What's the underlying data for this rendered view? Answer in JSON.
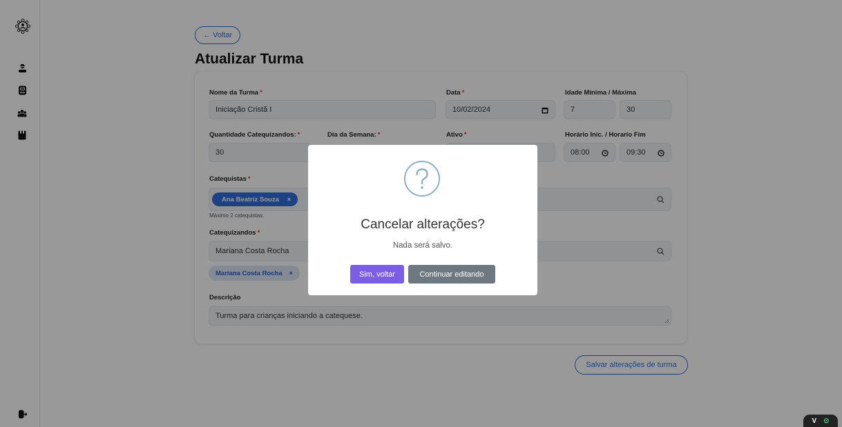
{
  "header": {
    "back_label": "← Voltar",
    "title": "Atualizar Turma"
  },
  "sidebar": {
    "icons": [
      "logo-icon",
      "user-icon",
      "book-icon",
      "group-icon",
      "notebook-icon",
      "logout-icon"
    ]
  },
  "form": {
    "nome": {
      "label": "Nome da Turma",
      "value": "Iniciação Cristã I"
    },
    "data": {
      "label": "Data",
      "value": "10/02/2024"
    },
    "idade": {
      "label": "Idade Mínima / Máxima",
      "min": "7",
      "max": "30"
    },
    "quantidade": {
      "label": "Quantidade Catequizandos:",
      "value": "30"
    },
    "dia_semana": {
      "label": "Dia da Semana:"
    },
    "ativo": {
      "label": "Ativo"
    },
    "horario": {
      "label": "Horário Inic. / Horario Fim",
      "inicio": "08:00",
      "fim": "09:30"
    },
    "catequistas": {
      "label": "Catequistas",
      "chip": "Ana Beatriz Souza",
      "hint": "Máximo 2 catequistas.",
      "partial": "E"
    },
    "catequizandos": {
      "label": "Catequizandos",
      "value": "Mariana Costa Rocha",
      "chip": "Mariana Costa Rocha"
    },
    "descricao": {
      "label": "Descrição",
      "value": "Turma para crianças iniciando a catequese."
    },
    "required_mark": "*",
    "chip_remove": "×"
  },
  "save_label": "Salvar alterações de turma",
  "modal": {
    "title": "Cancelar alterações?",
    "text": "Nada será salvo.",
    "confirm_label": "Sim, voltar",
    "cancel_label": "Continuar editando"
  },
  "devtools": {
    "label": "V",
    "indicator": "⊙"
  },
  "colors": {
    "primary": "#2f6fde",
    "confirm": "#7a5fe6",
    "secondary": "#6e7881",
    "required": "#e33333"
  }
}
